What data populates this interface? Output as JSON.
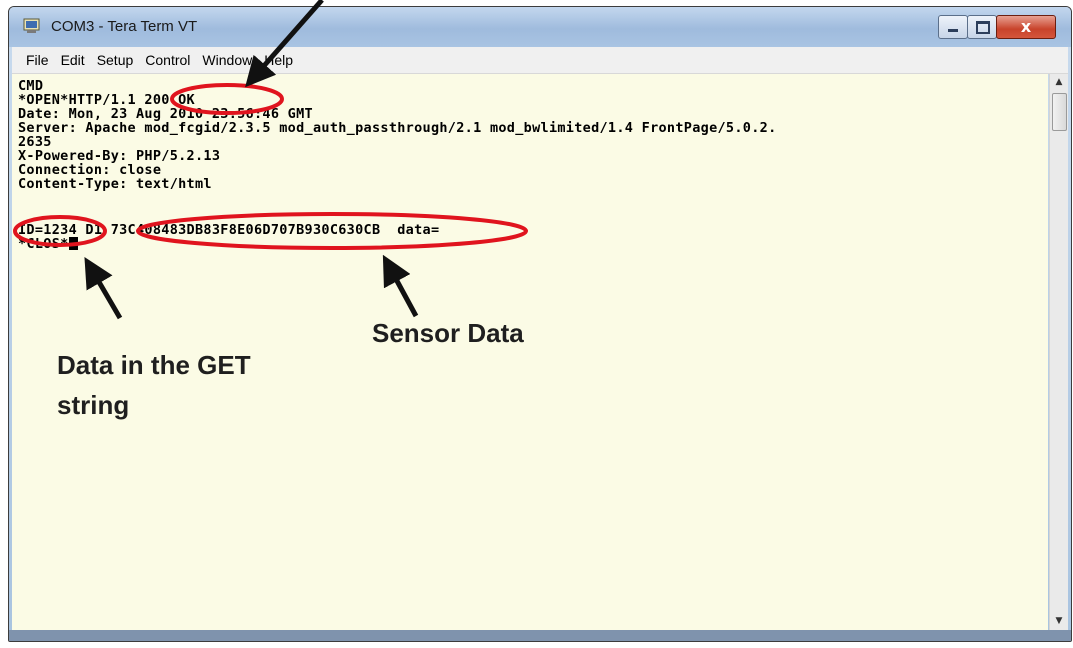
{
  "window": {
    "title": "COM3 - Tera Term VT",
    "close_glyph": "x"
  },
  "menu": {
    "items": [
      "File",
      "Edit",
      "Setup",
      "Control",
      "Window",
      "Help"
    ]
  },
  "terminal": {
    "lines": [
      "CMD",
      "*OPEN*HTTP/1.1 200 OK",
      "Date: Mon, 23 Aug 2010 23:56:46 GMT",
      "Server: Apache mod_fcgid/2.3.5 mod_auth_passthrough/2.1 mod_bwlimited/1.4 FrontPage/5.0.2.",
      "2635",
      "X-Powered-By: PHP/5.2.13",
      "Connection: close",
      "Content-Type: text/html",
      "",
      "ID=1234 D1 73C408483DB83F8E06D707B930C630CB  data=",
      "*CLOS*"
    ]
  },
  "annotations": {
    "sensor_label": "Sensor Data",
    "get_label_line1": "Data in the GET",
    "get_label_line2": "string",
    "highlight_color": "#e0141e"
  }
}
